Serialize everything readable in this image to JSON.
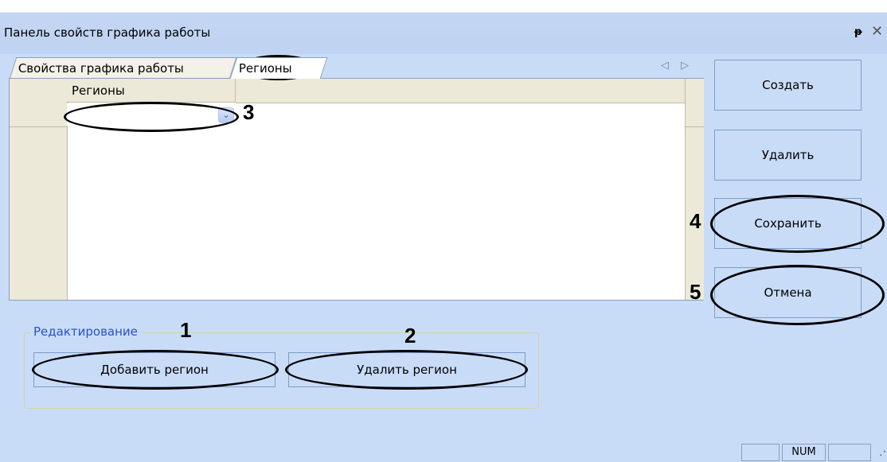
{
  "window": {
    "title": "Панель свойств графика работы",
    "pin_glyph": "ᵽ",
    "close_glyph": "✕"
  },
  "tabs": [
    {
      "label": "Свойства графика работы",
      "active": false
    },
    {
      "label": "Регионы",
      "active": true
    }
  ],
  "tab_nav": {
    "left_glyph": "◁",
    "right_glyph": "▷"
  },
  "grid": {
    "column_header": "Регионы",
    "rows": [
      {
        "value": ""
      }
    ]
  },
  "combo": {
    "arrow_glyph": "⌄"
  },
  "side_buttons": {
    "create": "Создать",
    "delete": "Удалить",
    "save": "Сохранить",
    "cancel": "Отмена"
  },
  "edit_group": {
    "legend": "Редактирование",
    "add_region": "Добавить регион",
    "delete_region": "Удалить регион"
  },
  "callouts": [
    "1",
    "2",
    "3",
    "4",
    "5"
  ],
  "status_bar": {
    "cells": [
      "",
      "NUM",
      ""
    ],
    "grip": "⋰"
  }
}
